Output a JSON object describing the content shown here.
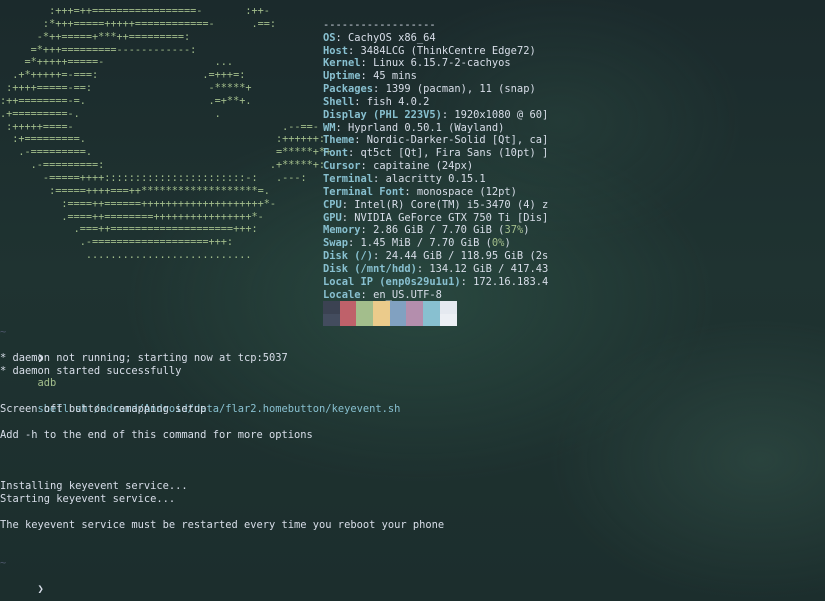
{
  "ascii_logo": [
    "        :+++=++=================-       :++-",
    "       :*+++=====+++++============-      .==:",
    "      -*++=====+***++=========:",
    "     =*+++=========------------:",
    "    =*+++++=====-                  ...",
    "  .+*+++++=-===:                 .=+++=:",
    " :++++=====-==:                   -*****+",
    ":++========-=.                    .=+**+.",
    ".+=========-.                      .",
    " :+++++====-                                  .--==-",
    "  :+=========.                               :++++++:",
    "   .-=========.                              =*****+*+",
    "     .-=========:                           .+*****+:",
    "       -=====++++:::::::::::::::::::::::-:   .---:",
    "        :=====++++===++*******************=.",
    "          :====++======++++++++++++++++++++*-",
    "          .====++========++++++++++++++++*-",
    "            .===++====================+++:",
    "             .-===================+++:",
    "              ..........................."
  ],
  "sysinfo": {
    "divider": "------------------",
    "rows": [
      {
        "key": "OS",
        "value": "CachyOS x86_64"
      },
      {
        "key": "Host",
        "value": "3484LCG (ThinkCentre Edge72)"
      },
      {
        "key": "Kernel",
        "value": "Linux 6.15.7-2-cachyos"
      },
      {
        "key": "Uptime",
        "value": "45 mins"
      },
      {
        "key": "Packages",
        "value": "1399 (pacman), 11 (snap)"
      },
      {
        "key": "Shell",
        "value": "fish 4.0.2"
      },
      {
        "key": "Display (PHL 223V5)",
        "value": "1920x1080 @ 60]"
      },
      {
        "key": "WM",
        "value": "Hyprland 0.50.1 (Wayland)"
      },
      {
        "key": "Theme",
        "value": "Nordic-Darker-Solid [Qt], ca]"
      },
      {
        "key": "Font",
        "value": "qt5ct [Qt], Fira Sans (10pt) ]"
      },
      {
        "key": "Cursor",
        "value": "capitaine (24px)"
      },
      {
        "key": "Terminal",
        "value": "alacritty 0.15.1"
      },
      {
        "key": "Terminal Font",
        "value": "monospace (12pt)"
      },
      {
        "key": "CPU",
        "value": "Intel(R) Core(TM) i5-3470 (4) z"
      },
      {
        "key": "GPU",
        "value": "NVIDIA GeForce GTX 750 Ti [Dis]"
      },
      {
        "key": "Memory",
        "value": "2.86 GiB / 7.70 GiB (",
        "pct": "37%",
        "tail": ")"
      },
      {
        "key": "Swap",
        "value": "1.45 MiB / 7.70 GiB (",
        "pct": "0%",
        "tail": ")"
      },
      {
        "key": "Disk (/)",
        "value": "24.44 GiB / 118.95 GiB (2s"
      },
      {
        "key": "Disk (/mnt/hdd)",
        "value": "134.12 GiB / 417.43"
      },
      {
        "key": "Local IP (enp0s29u1u1)",
        "value": "172.16.183.4"
      },
      {
        "key": "Locale",
        "value": "en_US.UTF-8"
      }
    ]
  },
  "palette": [
    {
      "top": "#3b4252",
      "bottom": "#434c5e"
    },
    {
      "top": "#bf616a",
      "bottom": "#bf616a"
    },
    {
      "top": "#a3be8c",
      "bottom": "#a3be8c"
    },
    {
      "top": "#ebcb8b",
      "bottom": "#ebcb8b"
    },
    {
      "top": "#81a1c1",
      "bottom": "#81a1c1"
    },
    {
      "top": "#b48ead",
      "bottom": "#b48ead"
    },
    {
      "top": "#88c0d0",
      "bottom": "#88c0d0"
    },
    {
      "top": "#e5e9f0",
      "bottom": "#eceff4"
    }
  ],
  "session": {
    "tilde_1": "~",
    "prompt_symbol": "❯",
    "command": {
      "program": "adb",
      "args": "shell sh /sdcard/Android/data/flar2.homebutton/keyevent.sh"
    },
    "output_lines": [
      "* daemon not running; starting now at tcp:5037",
      "* daemon started successfully",
      "",
      "",
      "Screen off button remapping setup",
      "",
      "Add -h to the end of this command for more options",
      "",
      "",
      "",
      "Installing keyevent service...",
      "Starting keyevent service...",
      "",
      "The keyevent service must be restarted every time you reboot your phone",
      "",
      ""
    ],
    "tilde_2": "~",
    "prompt_symbol_2": "❯"
  }
}
